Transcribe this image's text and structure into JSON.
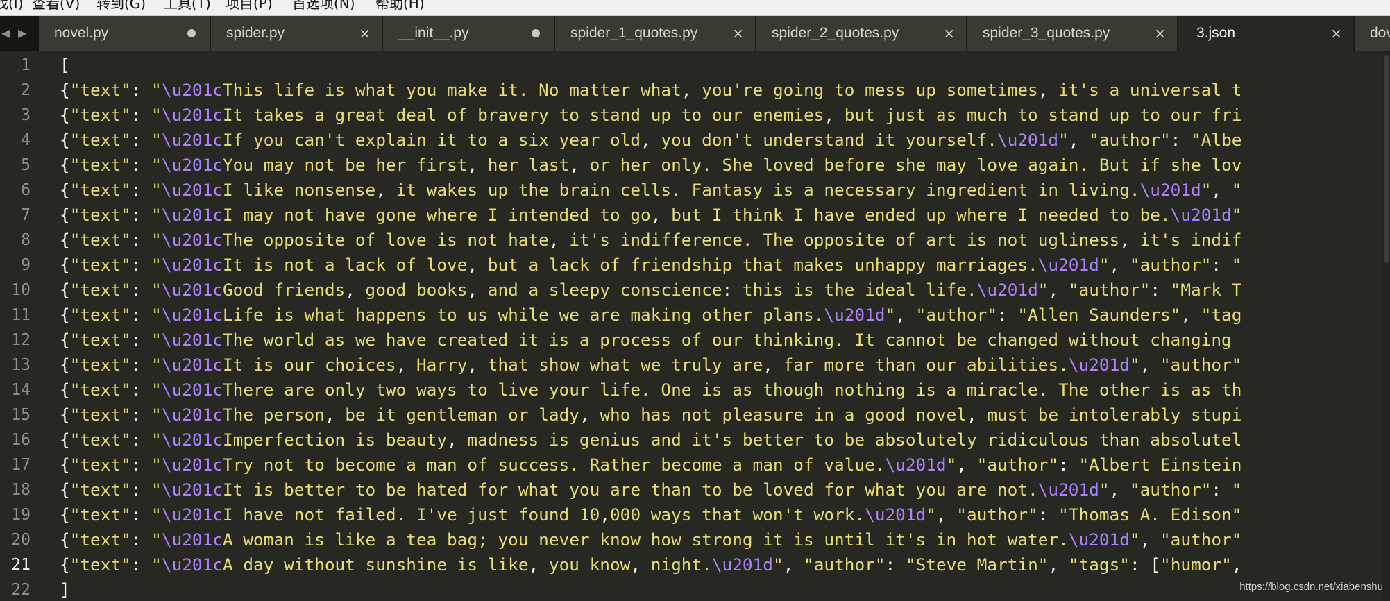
{
  "menubar": {
    "items": [
      "找(I)",
      "查看(V)",
      "转到(G)",
      "工具(T)",
      "项目(P)",
      "首选项(N)",
      "帮助(H)"
    ]
  },
  "tabbar": {
    "prev_arrow": "◀",
    "next_arrow": "▶",
    "tabs": [
      {
        "label": "novel.py",
        "state": "dirty",
        "active": false
      },
      {
        "label": "spider.py",
        "state": "close",
        "active": false
      },
      {
        "label": "__init__.py",
        "state": "dirty",
        "active": false
      },
      {
        "label": "spider_1_quotes.py",
        "state": "close",
        "active": false
      },
      {
        "label": "spider_2_quotes.py",
        "state": "close",
        "active": false
      },
      {
        "label": "spider_3_quotes.py",
        "state": "close",
        "active": false
      },
      {
        "label": "3.json",
        "state": "close",
        "active": true
      },
      {
        "label": "dov",
        "state": "none",
        "active": false
      }
    ],
    "close_glyph": "×"
  },
  "editor": {
    "current_line": 21,
    "lines": [
      {
        "n": "1",
        "text": "["
      },
      {
        "n": "2",
        "text": "{\"text\": \"\\u201cThis life is what you make it. No matter what, you're going to mess up sometimes, it's a universal t"
      },
      {
        "n": "3",
        "text": "{\"text\": \"\\u201cIt takes a great deal of bravery to stand up to our enemies, but just as much to stand up to our fri"
      },
      {
        "n": "4",
        "text": "{\"text\": \"\\u201cIf you can't explain it to a six year old, you don't understand it yourself.\\u201d\", \"author\": \"Albe"
      },
      {
        "n": "5",
        "text": "{\"text\": \"\\u201cYou may not be her first, her last, or her only. She loved before she may love again. But if she lov"
      },
      {
        "n": "6",
        "text": "{\"text\": \"\\u201cI like nonsense, it wakes up the brain cells. Fantasy is a necessary ingredient in living.\\u201d\", \""
      },
      {
        "n": "7",
        "text": "{\"text\": \"\\u201cI may not have gone where I intended to go, but I think I have ended up where I needed to be.\\u201d\""
      },
      {
        "n": "8",
        "text": "{\"text\": \"\\u201cThe opposite of love is not hate, it's indifference. The opposite of art is not ugliness, it's indif"
      },
      {
        "n": "9",
        "text": "{\"text\": \"\\u201cIt is not a lack of love, but a lack of friendship that makes unhappy marriages.\\u201d\", \"author\": \""
      },
      {
        "n": "10",
        "text": "{\"text\": \"\\u201cGood friends, good books, and a sleepy conscience: this is the ideal life.\\u201d\", \"author\": \"Mark T"
      },
      {
        "n": "11",
        "text": "{\"text\": \"\\u201cLife is what happens to us while we are making other plans.\\u201d\", \"author\": \"Allen Saunders\", \"tag"
      },
      {
        "n": "12",
        "text": "{\"text\": \"\\u201cThe world as we have created it is a process of our thinking. It cannot be changed without changing "
      },
      {
        "n": "13",
        "text": "{\"text\": \"\\u201cIt is our choices, Harry, that show what we truly are, far more than our abilities.\\u201d\", \"author\""
      },
      {
        "n": "14",
        "text": "{\"text\": \"\\u201cThere are only two ways to live your life. One is as though nothing is a miracle. The other is as th"
      },
      {
        "n": "15",
        "text": "{\"text\": \"\\u201cThe person, be it gentleman or lady, who has not pleasure in a good novel, must be intolerably stupi"
      },
      {
        "n": "16",
        "text": "{\"text\": \"\\u201cImperfection is beauty, madness is genius and it's better to be absolutely ridiculous than absolutel"
      },
      {
        "n": "17",
        "text": "{\"text\": \"\\u201cTry not to become a man of success. Rather become a man of value.\\u201d\", \"author\": \"Albert Einstein"
      },
      {
        "n": "18",
        "text": "{\"text\": \"\\u201cIt is better to be hated for what you are than to be loved for what you are not.\\u201d\", \"author\": \""
      },
      {
        "n": "19",
        "text": "{\"text\": \"\\u201cI have not failed. I've just found 10,000 ways that won't work.\\u201d\", \"author\": \"Thomas A. Edison\""
      },
      {
        "n": "20",
        "text": "{\"text\": \"\\u201cA woman is like a tea bag; you never know how strong it is until it's in hot water.\\u201d\", \"author\""
      },
      {
        "n": "21",
        "text": "{\"text\": \"\\u201cA day without sunshine is like, you know, night.\\u201d\", \"author\": \"Steve Martin\", \"tags\": [\"humor\","
      },
      {
        "n": "22",
        "text": "]"
      }
    ]
  },
  "watermark": "https://blog.csdn.net/xiabenshu",
  "colors": {
    "background": "#272822",
    "string": "#e6db74",
    "escape": "#ae81ff",
    "punctuation": "#f8f8f2",
    "line_number": "#8f908a"
  }
}
